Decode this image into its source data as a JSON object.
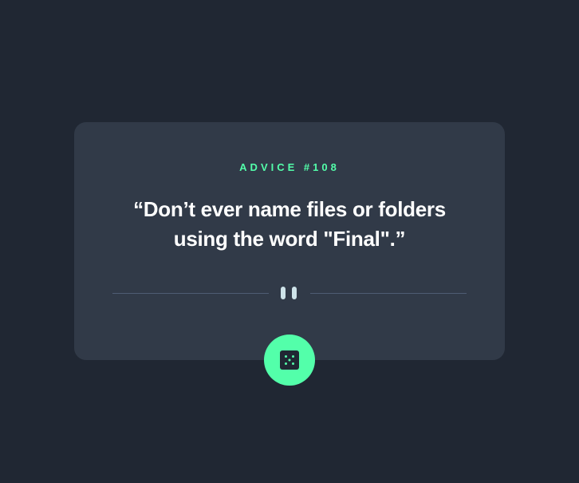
{
  "advice": {
    "label": "ADVICE #108",
    "quote_line1": "“Don’t ever name files or folders",
    "quote_line2": "using the word \"Final\".”"
  },
  "divider": {
    "icon": "pause-icon"
  },
  "generate_button": {
    "icon": "dice-icon"
  },
  "colors": {
    "background": "#202733",
    "card": "#313A48",
    "accent": "#53FFAA",
    "text": "#FFFFFF",
    "divider": "#4F5D74"
  }
}
